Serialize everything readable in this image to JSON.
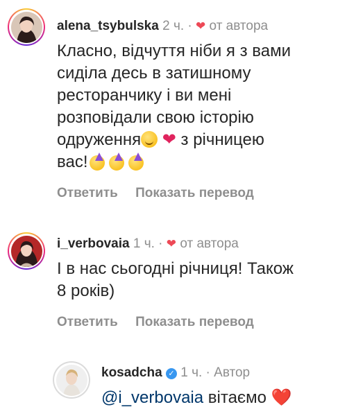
{
  "comments": [
    {
      "username": "alena_tsybulska",
      "time": "2 ч.",
      "sep": "·",
      "heart": "❤",
      "tag": "от автора",
      "lines": [
        "Класно, відчуття ніби я з вами",
        "сиділа десь в затишному",
        "ресторанчику і ви мені",
        "розповідали свою історію"
      ],
      "line5_start": "одруження",
      "line5_end": " з річницею",
      "line6": "вас!",
      "reply": "Ответить",
      "translate": "Показать перевод"
    },
    {
      "username": "i_verbovaia",
      "time": "1 ч.",
      "sep": "·",
      "heart": "❤",
      "tag": "от автора",
      "lines": [
        "І в нас сьогодні річниця! Також",
        "8 років)"
      ],
      "reply": "Ответить",
      "translate": "Показать перевод"
    },
    {
      "username": "kosadcha",
      "verified": "✓",
      "time": "1 ч.",
      "sep": "·",
      "tag": "Автор",
      "mention": "@i_verbovaia",
      "text": " вітаємо ",
      "heart": "❤️"
    }
  ]
}
